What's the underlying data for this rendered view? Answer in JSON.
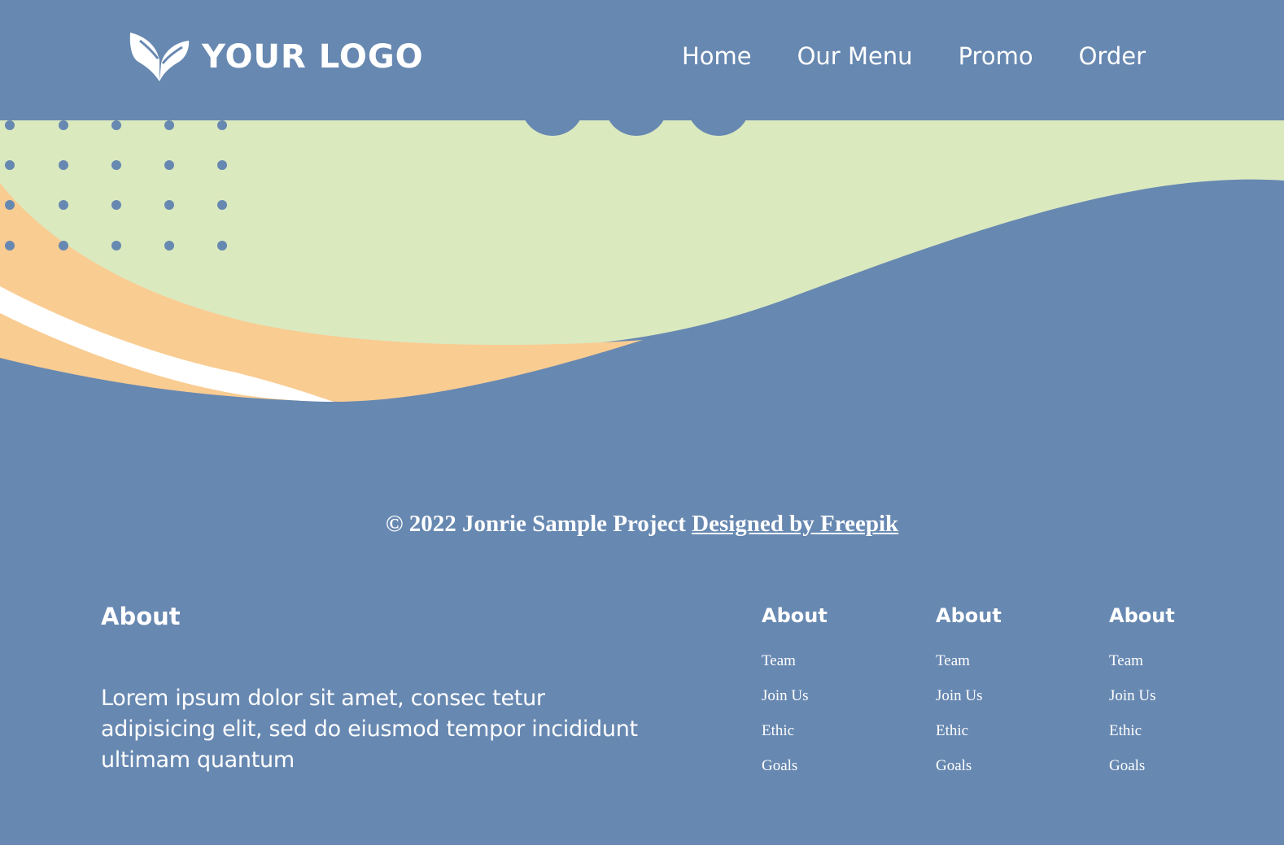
{
  "header": {
    "logo_text": "YOUR LOGO",
    "nav": [
      "Home",
      "Our Menu",
      "Promo",
      "Order"
    ]
  },
  "copyright": {
    "text": "© 2022 Jonrie Sample Project ",
    "link_text": "Designed by Freepik"
  },
  "footer": {
    "about": {
      "title": "About",
      "body": "Lorem ipsum dolor sit amet, consec tetur adipisicing elit, sed do eiusmod tempor incididunt ultimam quantum"
    },
    "columns": [
      {
        "title": "About",
        "links": [
          "Team",
          "Join Us",
          "Ethic",
          "Goals"
        ]
      },
      {
        "title": "About",
        "links": [
          "Team",
          "Join Us",
          "Ethic",
          "Goals"
        ]
      },
      {
        "title": "About",
        "links": [
          "Team",
          "Join Us",
          "Ethic",
          "Goals"
        ]
      }
    ]
  },
  "colors": {
    "primary_blue": "#6788b1",
    "light_green": "#dbe9bf",
    "peach": "#f9cc92",
    "white": "#ffffff"
  }
}
